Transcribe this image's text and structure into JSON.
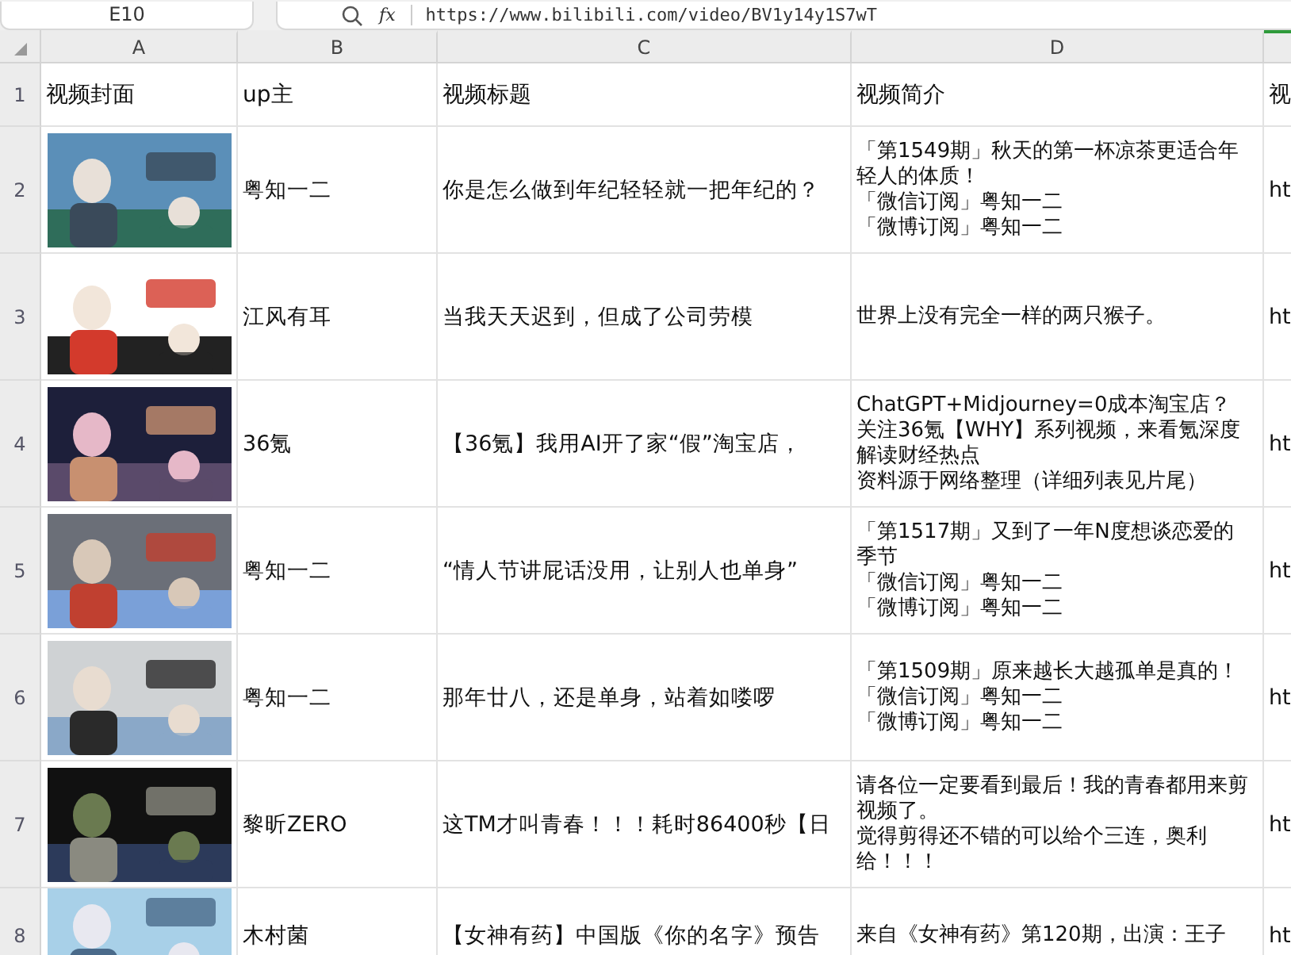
{
  "formula_bar": {
    "name_box": "E10",
    "function_label": "fx",
    "value": "https://www.bilibili.com/video/BV1y14y1S7wT"
  },
  "columns": [
    {
      "label": "A",
      "selected": false
    },
    {
      "label": "B",
      "selected": false
    },
    {
      "label": "C",
      "selected": false
    },
    {
      "label": "D",
      "selected": false
    },
    {
      "selected": true
    }
  ],
  "header_row": {
    "row": "1",
    "cells": [
      "视频封面",
      "up主",
      "视频标题",
      "视频简介",
      "视"
    ]
  },
  "rows": [
    {
      "row": "2",
      "cover": {
        "kind": "picture"
      },
      "uploader": "粤知一二",
      "title": "你是怎么做到年纪轻轻就一把年纪的？",
      "description": [
        "「第1549期」秋天的第一杯凉茶更适合年轻人的体质！",
        "「微信订阅」粤知一二",
        "「微博订阅」粤知一二"
      ],
      "column_e": "ht"
    },
    {
      "row": "3",
      "cover": {
        "kind": "picture"
      },
      "uploader": "江风有耳",
      "title": "当我天天迟到，但成了公司劳模",
      "description": [
        "世界上没有完全一样的两只猴子。"
      ],
      "column_e": "ht"
    },
    {
      "row": "4",
      "cover": {
        "kind": "picture"
      },
      "uploader": "36氪",
      "title": "【36氪】我用AI开了家“假”淘宝店，",
      "description": [
        "ChatGPT+Midjourney=0成本淘宝店？",
        "关注36氪【WHY】系列视频，来看氪深度解读财经热点",
        "资料源于网络整理（详细列表见片尾）"
      ],
      "column_e": "ht"
    },
    {
      "row": "5",
      "cover": {
        "kind": "picture"
      },
      "uploader": "粤知一二",
      "title": "“情人节讲屁话没用，让别人也单身”",
      "description": [
        "「第1517期」又到了一年N度想谈恋爱的季节",
        "「微信订阅」粤知一二",
        "「微博订阅」粤知一二"
      ],
      "column_e": "ht"
    },
    {
      "row": "6",
      "cover": {
        "kind": "picture"
      },
      "uploader": "粤知一二",
      "title": "那年廿八，还是单身，站着如喽啰",
      "description": [
        "「第1509期」原来越长大越孤单是真的！",
        "「微信订阅」粤知一二",
        "「微博订阅」粤知一二"
      ],
      "column_e": "ht"
    },
    {
      "row": "7",
      "cover": {
        "kind": "picture"
      },
      "uploader": "黎昕ZERO",
      "title": "这TM才叫青春！！！耗时86400秒【日",
      "description": [
        "请各位一定要看到最后！我的青春都用来剪视频了。",
        "觉得剪得还不错的可以给个三连，奥利给！！！"
      ],
      "column_e": "ht"
    },
    {
      "row": "8",
      "cover": {
        "kind": "picture"
      },
      "uploader": "木村菌",
      "title": "【女神有药】中国版《你的名字》预告",
      "description": [
        "来自《女神有药》第120期，出演：王子"
      ],
      "column_e": "ht"
    }
  ]
}
